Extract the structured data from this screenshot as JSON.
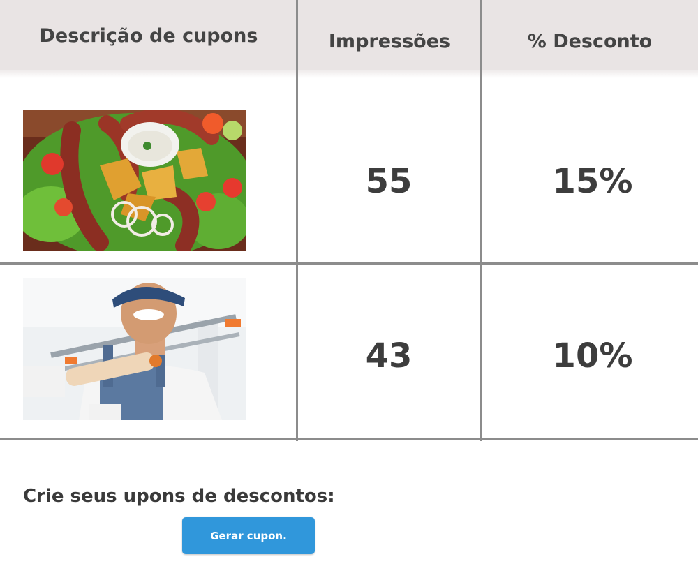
{
  "table": {
    "headers": {
      "description": "Descrição de cupons",
      "impressions": "Impressões",
      "discount": "% Desconto"
    },
    "rows": [
      {
        "image": "food-platter-image",
        "impressions": "55",
        "discount": "15%"
      },
      {
        "image": "painter-worker-image",
        "impressions": "43",
        "discount": "10%"
      }
    ]
  },
  "footer": {
    "prompt": "Crie seus upons de descontos:",
    "button_label": "Gerar cupon."
  },
  "colors": {
    "header_bg": "#e9e4e4",
    "grid_line": "#8c8c8c",
    "button_bg": "#3097db",
    "text": "#3f3f3f"
  }
}
